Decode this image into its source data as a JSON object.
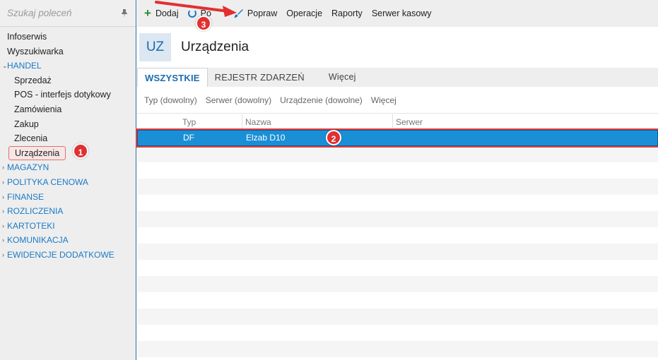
{
  "sidebar": {
    "search_placeholder": "Szukaj poleceń",
    "items": [
      {
        "label": "Infoserwis"
      },
      {
        "label": "Wyszukiwarka"
      },
      {
        "label": "HANDEL"
      },
      {
        "label": "Sprzedaż"
      },
      {
        "label": "POS - interfejs dotykowy"
      },
      {
        "label": "Zamówienia"
      },
      {
        "label": "Zakup"
      },
      {
        "label": "Zlecenia"
      },
      {
        "label": "Urządzenia"
      },
      {
        "label": "MAGAZYN"
      },
      {
        "label": "POLITYKA CENOWA"
      },
      {
        "label": "FINANSE"
      },
      {
        "label": "ROZLICZENIA"
      },
      {
        "label": "KARTOTEKI"
      },
      {
        "label": "KOMUNIKACJA"
      },
      {
        "label": "EWIDENCJE DODATKOWE"
      }
    ]
  },
  "toolbar": {
    "add_label": "Dodaj",
    "refresh_label": "Po",
    "edit_label": "Popraw",
    "operations_label": "Operacje",
    "reports_label": "Raporty",
    "cash_server_label": "Serwer kasowy"
  },
  "header": {
    "badge": "UZ",
    "title": "Urządzenia"
  },
  "tabs": {
    "all": "WSZYSTKIE",
    "events": "REJESTR ZDARZEŃ",
    "more": "Więcej"
  },
  "filters": {
    "type": "Typ (dowolny)",
    "server": "Serwer (dowolny)",
    "device": "Urządzenie (dowolne)",
    "more": "Więcej"
  },
  "grid": {
    "columns": {
      "type": "Typ",
      "name": "Nazwa",
      "server": "Serwer"
    },
    "rows": [
      {
        "type": "DF",
        "name": "Elzab D10",
        "server": ""
      }
    ]
  },
  "annotations": {
    "one": "1",
    "two": "2",
    "three": "3"
  },
  "colors": {
    "accent": "#1a7ac6",
    "selection": "#1a8fd6",
    "annotation": "#e23030"
  }
}
